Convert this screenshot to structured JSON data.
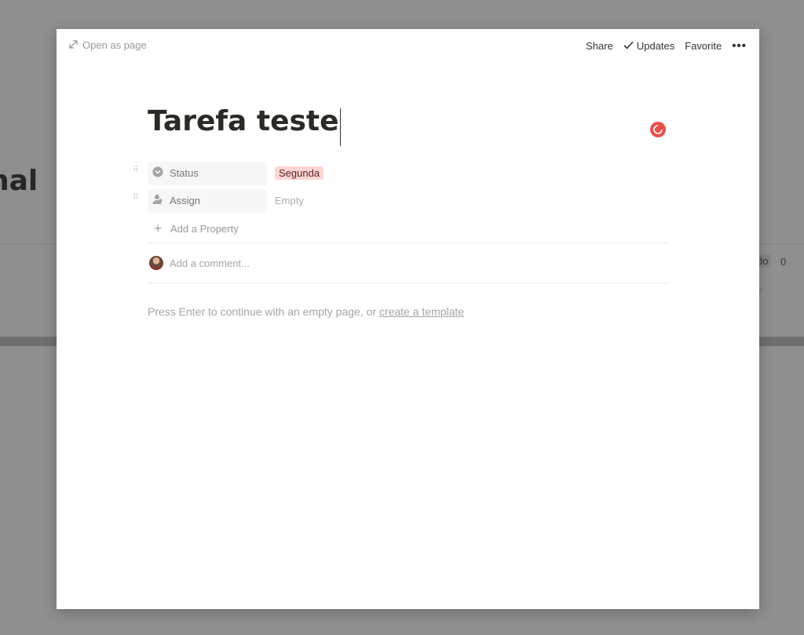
{
  "background": {
    "title_fragment": "nal",
    "tag_fragment": "do",
    "count": "0",
    "sub_fragment": "w"
  },
  "topbar": {
    "open_as_page": "Open as page",
    "share": "Share",
    "updates": "Updates",
    "favorite": "Favorite"
  },
  "page": {
    "title": "Tarefa teste",
    "status_color": "#e8514a"
  },
  "properties": [
    {
      "name": "Status",
      "icon": "chevron-circle-icon",
      "value": "Segunda",
      "value_bg": "#ffd5d3"
    },
    {
      "name": "Assign",
      "icon": "person-icon",
      "value": "Empty"
    }
  ],
  "add_property": "Add a Property",
  "comment": {
    "placeholder": "Add a comment..."
  },
  "hint": {
    "text": "Press Enter to continue with an empty page, or ",
    "link": "create a template"
  }
}
